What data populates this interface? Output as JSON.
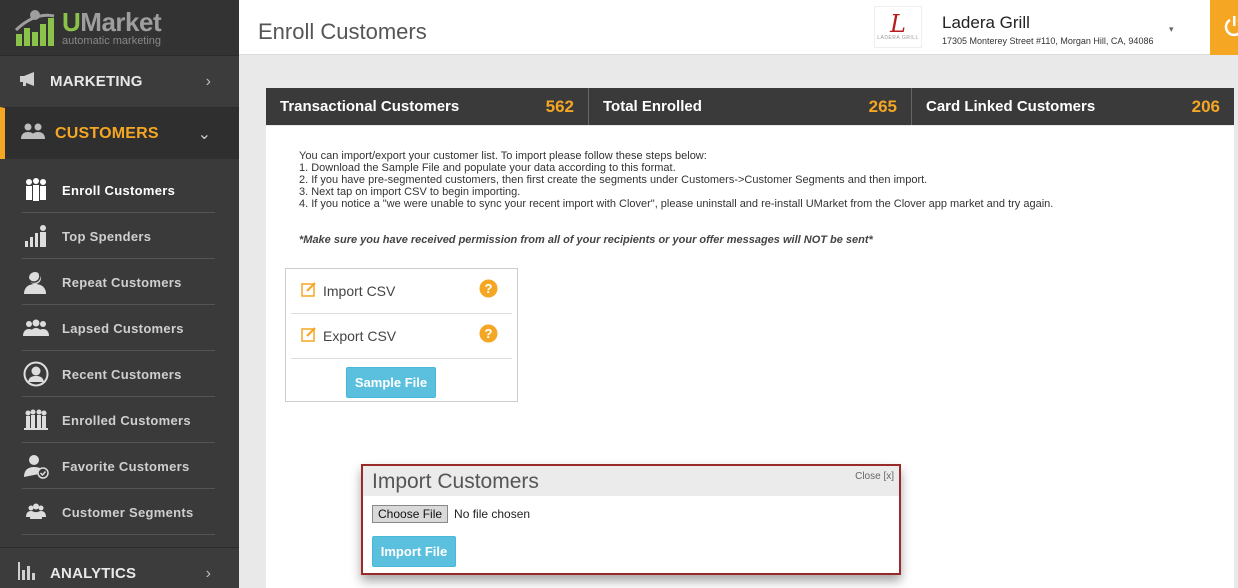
{
  "brand": {
    "name_u": "U",
    "name_rest": "Market",
    "tagline": "automatic marketing"
  },
  "sidebar": {
    "sections": [
      {
        "label": "MARKETING"
      },
      {
        "label": "CUSTOMERS"
      },
      {
        "label": "ANALYTICS"
      }
    ],
    "customer_items": [
      {
        "label": "Enroll Customers"
      },
      {
        "label": "Top Spenders"
      },
      {
        "label": "Repeat Customers"
      },
      {
        "label": "Lapsed Customers"
      },
      {
        "label": "Recent Customers"
      },
      {
        "label": "Enrolled Customers"
      },
      {
        "label": "Favorite Customers"
      },
      {
        "label": "Customer Segments"
      }
    ]
  },
  "header": {
    "title": "Enroll Customers",
    "business": {
      "logo_mark": "L",
      "logo_caption": "LADERA GRILL",
      "name": "Ladera Grill",
      "address": "17305 Monterey Street #110, Morgan Hill, CA, 94086"
    }
  },
  "stats": [
    {
      "label": "Transactional Customers",
      "value": "562"
    },
    {
      "label": "Total Enrolled",
      "value": "265"
    },
    {
      "label": "Card Linked Customers",
      "value": "206"
    }
  ],
  "instructions": {
    "lines": [
      "You can import/export your customer list. To import please follow these steps below:",
      "1. Download the Sample File and populate your data according to this format.",
      "2. If you have pre-segmented customers, then first create the segments under Customers->Customer Segments and then import.",
      "3. Next tap on import CSV to begin importing.",
      "4. If you notice a \"we were unable to sync your recent import with Clover\", please uninstall and re-install UMarket from the Clover app market and try again."
    ],
    "warning": "*Make sure you have received permission from all of your recipients or your offer messages will NOT be sent*"
  },
  "csv_box": {
    "import_label": "Import CSV",
    "export_label": "Export CSV",
    "sample_button": "Sample File"
  },
  "modal": {
    "title": "Import Customers",
    "close_label": "Close [x]",
    "choose_button": "Choose File",
    "file_status": "No file chosen",
    "import_button": "Import File"
  },
  "colors": {
    "accent": "#f5a623",
    "sidebar": "#3a3a3a",
    "button": "#5bc0de",
    "modal_border": "#9a2a2a"
  }
}
